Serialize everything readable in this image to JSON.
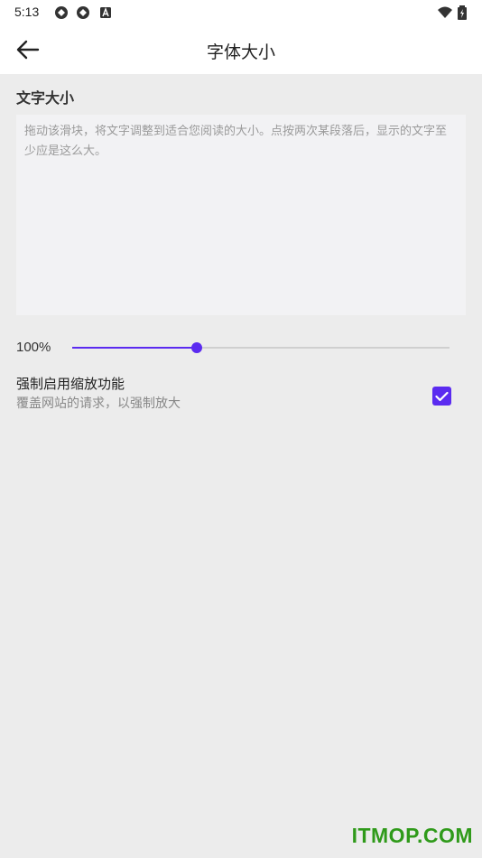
{
  "status_bar": {
    "time": "5:13",
    "left_icons": [
      "sync-icon",
      "sync-icon",
      "a-badge-icon"
    ],
    "right_icons": [
      "wifi-icon",
      "battery-charging-icon"
    ]
  },
  "app_bar": {
    "back_icon": "arrow-left-icon",
    "title": "字体大小"
  },
  "text_size": {
    "section_title": "文字大小",
    "preview_text": "拖动该滑块，将文字调整到适合您阅读的大小。点按两次某段落后，显示的文字至少应是这么大。",
    "zoom_percent_label": "100%",
    "slider_value_fraction": 0.33
  },
  "force_zoom": {
    "title": "强制启用缩放功能",
    "subtitle": "覆盖网站的请求，以强制放大",
    "checked": true
  },
  "colors": {
    "accent": "#5b2bf0",
    "background": "#ececec",
    "bar_background": "#ffffff",
    "preview_background": "#f2f2f4",
    "watermark": "#2f9a1a"
  },
  "watermark": "ITMOP.COM"
}
